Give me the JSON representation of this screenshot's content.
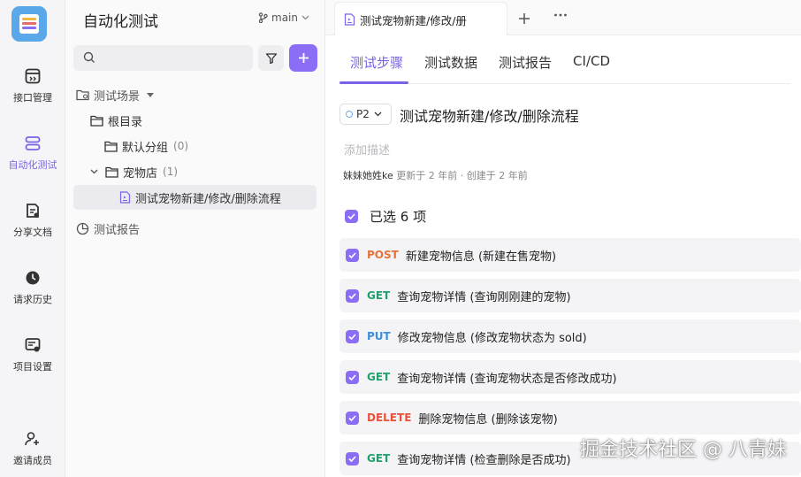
{
  "rail": {
    "items": [
      {
        "label": "接口管理",
        "icon": "api-icon"
      },
      {
        "label": "自动化测试",
        "icon": "automation-icon",
        "active": true
      },
      {
        "label": "分享文档",
        "icon": "share-doc-icon"
      },
      {
        "label": "请求历史",
        "icon": "history-icon"
      },
      {
        "label": "项目设置",
        "icon": "settings-icon"
      },
      {
        "label": "邀请成员",
        "icon": "invite-icon"
      }
    ]
  },
  "sidebar": {
    "title": "自动化测试",
    "branch": "main",
    "search_placeholder": "",
    "tree": {
      "scenes_label": "测试场景",
      "root_label": "根目录",
      "default_group": {
        "label": "默认分组",
        "count": "(0)"
      },
      "pet_store": {
        "label": "宠物店",
        "count": "(1)"
      },
      "case_label": "测试宠物新建/修改/删除流程",
      "reports_label": "测试报告"
    }
  },
  "main": {
    "doc_tab": "测试宠物新建/修改/册",
    "subtabs": [
      "测试步骤",
      "测试数据",
      "测试报告",
      "CI/CD"
    ],
    "priority": "P2",
    "case_title": "测试宠物新建/修改/删除流程",
    "description_placeholder": "添加描述",
    "meta": {
      "author": "妹妹她姓ke",
      "updated": "更新于 2 年前",
      "separator": "·",
      "created": "创建于 2 年前"
    },
    "selected_label": "已选 6 项",
    "steps": [
      {
        "method": "POST",
        "text": "新建宠物信息 (新建在售宠物)"
      },
      {
        "method": "GET",
        "text": "查询宠物详情 (查询刚刚建的宠物)"
      },
      {
        "method": "PUT",
        "text": "修改宠物信息 (修改宠物状态为 sold)"
      },
      {
        "method": "GET",
        "text": "查询宠物详情 (查询宠物状态是否修改成功)"
      },
      {
        "method": "DELETE",
        "text": "删除宠物信息 (删除该宠物)"
      },
      {
        "method": "GET",
        "text": "查询宠物详情 (检查删除是否成功)"
      }
    ]
  },
  "colors": {
    "accent": "#7b61e8",
    "POST": "#e8713a",
    "GET": "#22a06b",
    "PUT": "#3d8fe0",
    "DELETE": "#e8503a"
  },
  "watermark": "掘金技术社区 @ 八青妹"
}
